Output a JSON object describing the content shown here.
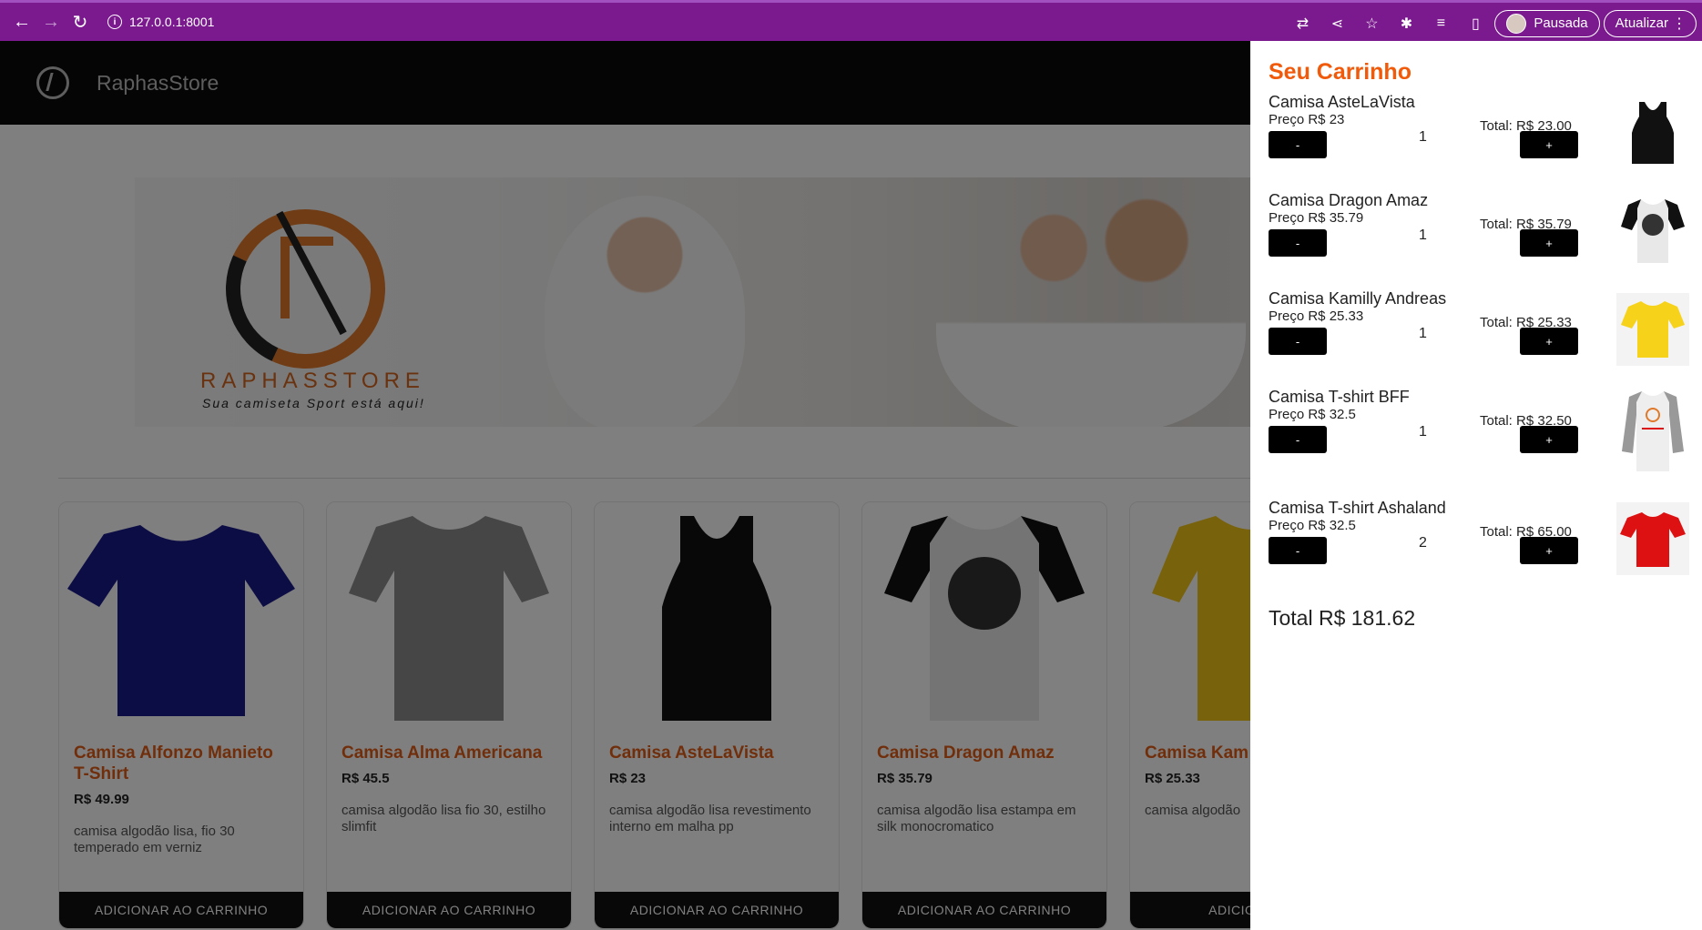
{
  "browser": {
    "url": "127.0.0.1:8001",
    "profile_label": "Pausada",
    "update_label": "Atualizar"
  },
  "header": {
    "brand": "RaphasStore"
  },
  "hero": {
    "wordmark": "RAPHASSTORE",
    "tagline": "Sua camiseta Sport está aqui!"
  },
  "products": [
    {
      "name": "Camisa Alfonzo Manieto T-Shirt",
      "price": "R$ 49.99",
      "desc": "camisa algodão lisa, fio 30 temperado em verniz",
      "button": "ADICIONAR AO CARRINHO",
      "color": "#1a1a8c"
    },
    {
      "name": "Camisa Alma Americana",
      "price": "R$ 45.5",
      "desc": "camisa algodão lisa fio 30, estilho slimfit",
      "button": "ADICIONAR AO CARRINHO",
      "color": "#8c8c8c"
    },
    {
      "name": "Camisa AsteLaVista",
      "price": "R$ 23",
      "desc": "camisa algodão lisa revestimento interno em malha pp",
      "button": "ADICIONAR AO CARRINHO",
      "color": "#111111"
    },
    {
      "name": "Camisa Dragon Amaz",
      "price": "R$ 35.79",
      "desc": "camisa algodão lisa estampa em silk monocromatico",
      "button": "ADICIONAR AO CARRINHO",
      "color": "#222222"
    },
    {
      "name": "Camisa Kam",
      "price": "R$ 25.33",
      "desc": "camisa algodão",
      "button": "ADICIONAR A",
      "color": "#f0c419"
    }
  ],
  "cart": {
    "title": "Seu Carrinho",
    "items": [
      {
        "name": "Camisa AsteLaVista",
        "price": "Preço R$ 23",
        "qty": "1",
        "total": "Total: R$ 23.00",
        "minus": "-",
        "plus": "+",
        "color": "#111111"
      },
      {
        "name": "Camisa Dragon Amaz",
        "price": "Preço R$ 35.79",
        "qty": "1",
        "total": "Total: R$ 35.79",
        "minus": "-",
        "plus": "+",
        "color": "#222222"
      },
      {
        "name": "Camisa Kamilly Andreas",
        "price": "Preço R$ 25.33",
        "qty": "1",
        "total": "Total: R$ 25.33",
        "minus": "-",
        "plus": "+",
        "color": "#f7d21a"
      },
      {
        "name": "Camisa T-shirt BFF",
        "price": "Preço R$ 32.5",
        "qty": "1",
        "total": "Total: R$ 32.50",
        "minus": "-",
        "plus": "+",
        "color": "#9a9a9a"
      },
      {
        "name": "Camisa T-shirt Ashaland",
        "price": "Preço R$ 32.5",
        "qty": "2",
        "total": "Total: R$ 65.00",
        "minus": "-",
        "plus": "+",
        "color": "#dd1111"
      }
    ],
    "grand_total": "Total R$ 181.62"
  }
}
